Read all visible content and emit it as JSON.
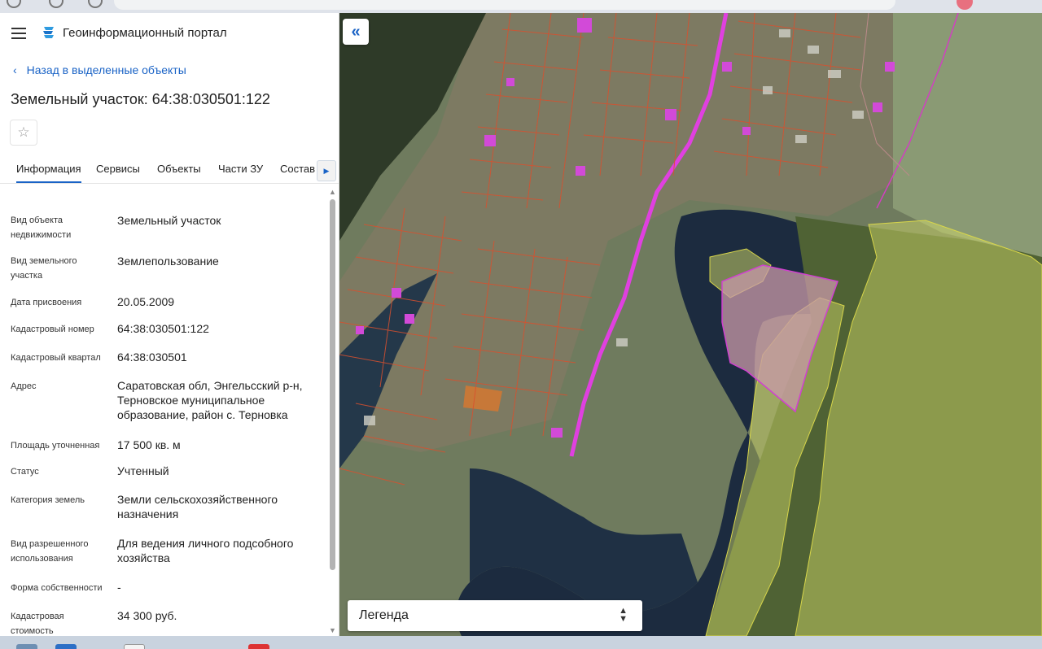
{
  "app": {
    "title": "Геоинформационный портал",
    "menu_icon": "hamburger-icon",
    "logo_icon": "portal-logo-icon"
  },
  "nav": {
    "back_label": "Назад в выделенные объекты"
  },
  "object": {
    "title": "Земельный участок: 64:38:030501:122",
    "favorite_icon": "star-icon"
  },
  "tabs": [
    {
      "label": "Информация",
      "active": true
    },
    {
      "label": "Сервисы"
    },
    {
      "label": "Объекты"
    },
    {
      "label": "Части ЗУ"
    },
    {
      "label": "Состав"
    }
  ],
  "fields": [
    {
      "label": "Вид объекта недвижимости",
      "value": "Земельный участок"
    },
    {
      "label": "Вид земельного участка",
      "value": "Землепользование"
    },
    {
      "label": "Дата присвоения",
      "value": "20.05.2009"
    },
    {
      "label": "Кадастровый номер",
      "value": "64:38:030501:122"
    },
    {
      "label": "Кадастровый квартал",
      "value": "64:38:030501"
    },
    {
      "label": "Адрес",
      "value": "Саратовская обл, Энгельсский р-н, Терновское муниципальное образование, район с. Терновка"
    },
    {
      "label": "Площадь уточненная",
      "value": "17 500 кв. м"
    },
    {
      "label": "Статус",
      "value": "Учтенный"
    },
    {
      "label": "Категория земель",
      "value": "Земли сельскохозяйственного назначения"
    },
    {
      "label": "Вид разрешенного использования",
      "value": "Для ведения личного подсобного хозяйства"
    },
    {
      "label": "Форма собственности",
      "value": "-"
    },
    {
      "label": "Кадастровая стоимость",
      "value": "34 300 руб."
    }
  ],
  "map": {
    "collapse_label": "«",
    "legend_label": "Легенда",
    "colors": {
      "parcel_border": "#d9502e",
      "road_highlight": "#e040e0",
      "zone_yellow": "#d8e06a",
      "selected_parcel": "#c89aa8"
    }
  }
}
